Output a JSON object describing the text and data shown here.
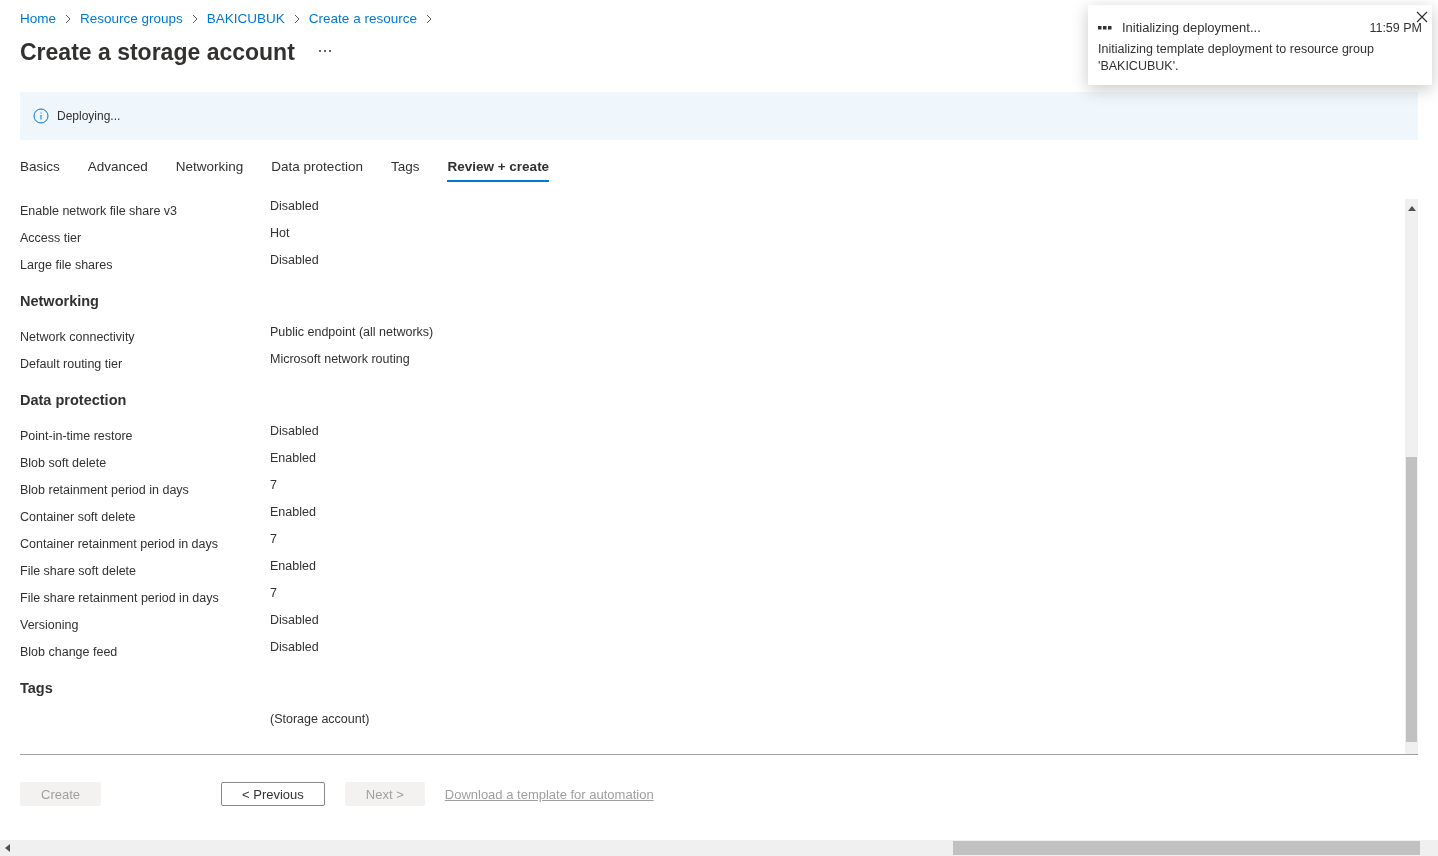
{
  "breadcrumb": [
    "Home",
    "Resource groups",
    "BAKICUBUK",
    "Create a resource"
  ],
  "title": "Create a storage account",
  "banner": {
    "text": "Deploying..."
  },
  "tabs": [
    {
      "label": "Basics",
      "selected": false
    },
    {
      "label": "Advanced",
      "selected": false
    },
    {
      "label": "Networking",
      "selected": false
    },
    {
      "label": "Data protection",
      "selected": false
    },
    {
      "label": "Tags",
      "selected": false
    },
    {
      "label": "Review + create",
      "selected": true
    }
  ],
  "sections": [
    {
      "rows": [
        {
          "label": "Enable network file share v3",
          "value": "Disabled"
        },
        {
          "label": "Access tier",
          "value": "Hot"
        },
        {
          "label": "Large file shares",
          "value": "Disabled"
        }
      ]
    },
    {
      "heading": "Networking",
      "rows": [
        {
          "label": "Network connectivity",
          "value": "Public endpoint (all networks)"
        },
        {
          "label": "Default routing tier",
          "value": "Microsoft network routing"
        }
      ]
    },
    {
      "heading": "Data protection",
      "rows": [
        {
          "label": "Point-in-time restore",
          "value": "Disabled"
        },
        {
          "label": "Blob soft delete",
          "value": "Enabled"
        },
        {
          "label": "Blob retainment period in days",
          "value": "7"
        },
        {
          "label": "Container soft delete",
          "value": "Enabled"
        },
        {
          "label": "Container retainment period in days",
          "value": "7"
        },
        {
          "label": "File share soft delete",
          "value": "Enabled"
        },
        {
          "label": "File share retainment period in days",
          "value": "7"
        },
        {
          "label": "Versioning",
          "value": "Disabled"
        },
        {
          "label": "Blob change feed",
          "value": "Disabled"
        }
      ]
    },
    {
      "heading": "Tags",
      "rows": [
        {
          "value": "(Storage account)"
        }
      ]
    }
  ],
  "footer": {
    "buttons": [
      {
        "label": "Create",
        "kind": "primary",
        "disabled": true
      },
      {
        "label": "< Previous",
        "kind": "secondary",
        "disabled": false
      },
      {
        "label": "Next >",
        "kind": "secondary",
        "disabled": true
      }
    ],
    "link": {
      "text": "Download a template for automation",
      "disabled": true
    }
  },
  "notification": {
    "title": "Initializing deployment...",
    "time": "11:59 PM",
    "message": "Initializing template deployment to resource group 'BAKICUBUK'."
  }
}
